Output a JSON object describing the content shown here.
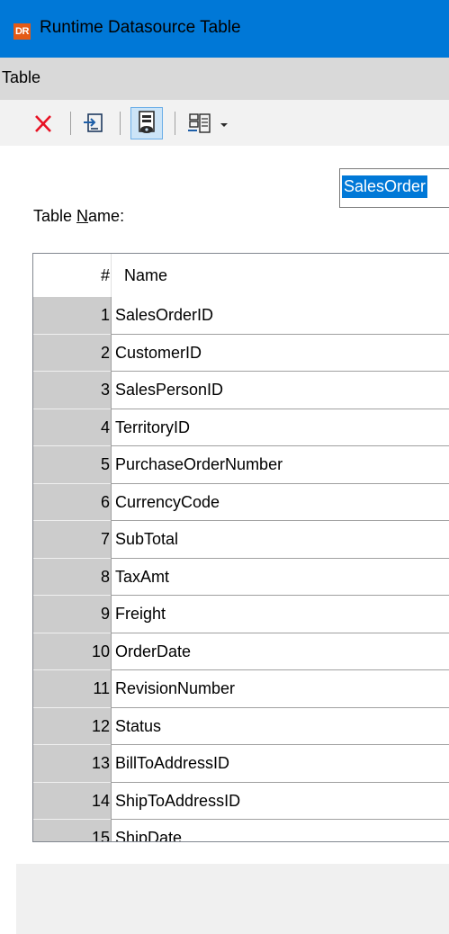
{
  "window": {
    "app_icon_text": "DR",
    "title": "Runtime Datasource Table"
  },
  "menu": {
    "items": [
      "Table"
    ]
  },
  "toolbar": {
    "buttons": [
      {
        "name": "delete",
        "icon": "red-x-icon",
        "color": "#e81123"
      },
      {
        "name": "import",
        "icon": "import-icon"
      },
      {
        "name": "preview",
        "icon": "preview-icon",
        "pressed": true
      },
      {
        "name": "options",
        "icon": "grid-options-icon",
        "has_dropdown": true
      }
    ]
  },
  "form": {
    "name_label_prefix": "Table ",
    "name_label_mnemonic": "N",
    "name_label_suffix": "ame:",
    "name_value": "SalesOrder"
  },
  "grid": {
    "headers": {
      "number": "#",
      "name": "Name"
    },
    "rows": [
      {
        "num": "1",
        "name": "SalesOrderID"
      },
      {
        "num": "2",
        "name": "CustomerID"
      },
      {
        "num": "3",
        "name": "SalesPersonID"
      },
      {
        "num": "4",
        "name": "TerritoryID"
      },
      {
        "num": "5",
        "name": "PurchaseOrderNumber"
      },
      {
        "num": "6",
        "name": "CurrencyCode"
      },
      {
        "num": "7",
        "name": "SubTotal"
      },
      {
        "num": "8",
        "name": "TaxAmt"
      },
      {
        "num": "9",
        "name": "Freight"
      },
      {
        "num": "10",
        "name": "OrderDate"
      },
      {
        "num": "11",
        "name": "RevisionNumber"
      },
      {
        "num": "12",
        "name": "Status"
      },
      {
        "num": "13",
        "name": "BillToAddressID"
      },
      {
        "num": "14",
        "name": "ShipToAddressID"
      },
      {
        "num": "15",
        "name": "ShipDate"
      }
    ]
  },
  "colors": {
    "titlebar": "#0078d7",
    "menubar": "#d9d9d9",
    "row_header": "#cccccc",
    "selection": "#0078d7"
  }
}
